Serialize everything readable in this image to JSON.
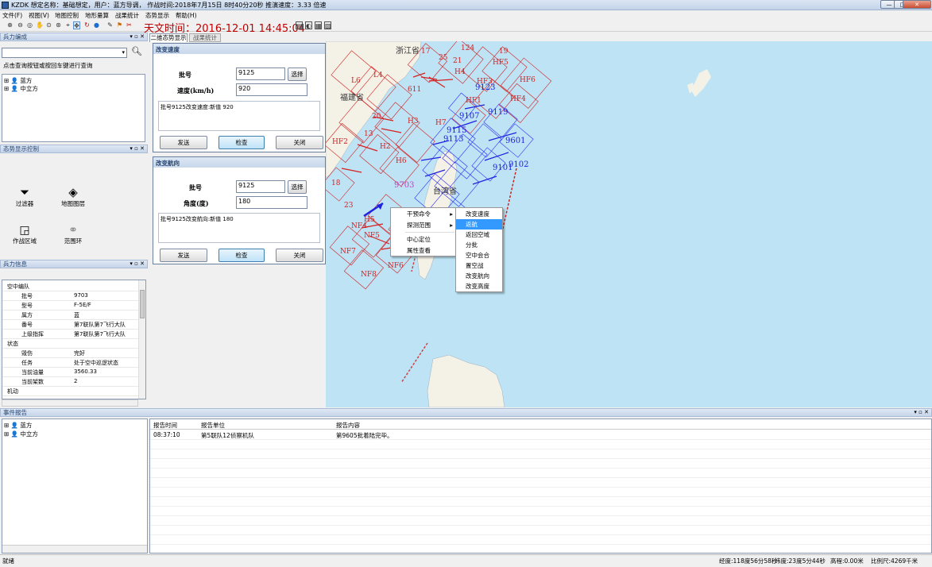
{
  "window": {
    "title": "KZDK  想定名称：基础想定，用户：蓝方导调，   作战时间:2018年7月15日 8时40分20秒    推演速度：3.33 倍速",
    "minimize": "—",
    "maximize": "□",
    "close": "✕"
  },
  "menu": [
    "文件(F)",
    "视图(V)",
    "地图控制",
    "地形量算",
    "战果统计",
    "态势显示",
    "帮助(H)"
  ],
  "toolbar": {
    "sky_time": "天文时间：2016-12-01 14:45:04"
  },
  "tabs": {
    "situation": "二维态势显示",
    "stats": "战果统计"
  },
  "force_panel": {
    "title": "兵力编成",
    "controls": "▾ ▫ ✕",
    "search_hint": "点击查询按钮或按回车键进行查询",
    "tree": [
      "蓝方",
      "中立方"
    ]
  },
  "situation_panel": {
    "title": "态势显示控制",
    "controls": "▾ ▫ ✕",
    "tools": [
      "过滤器",
      "地图图层",
      "作战区域",
      "范围环"
    ]
  },
  "force_info": {
    "title": "兵力信息",
    "controls": "▾ ▫ ✕",
    "groups": [
      {
        "name": "空中编队",
        "rows": [
          {
            "k": "批号",
            "v": "9703"
          },
          {
            "k": "型号",
            "v": "F-5E/F"
          },
          {
            "k": "属方",
            "v": "蓝"
          },
          {
            "k": "番号",
            "v": "第7联队第7飞行大队"
          },
          {
            "k": "上级指挥",
            "v": "第7联队第7飞行大队"
          }
        ]
      },
      {
        "name": "状态",
        "rows": [
          {
            "k": "毁伤",
            "v": "完好"
          },
          {
            "k": "任务",
            "v": "处于空中巡逻状态"
          },
          {
            "k": "当前油量",
            "v": "3560.33"
          },
          {
            "k": "当前架数",
            "v": "2"
          }
        ]
      },
      {
        "name": "机动",
        "rows": []
      }
    ]
  },
  "speed_dialog": {
    "title": "改变速度",
    "batch_label": "批号",
    "batch_value": "9125",
    "value_label": "速度(km/h)",
    "value": "920",
    "select": "选择",
    "log": "批号9125改变速度:新值 920",
    "send": "发送",
    "check": "检查",
    "close": "关闭"
  },
  "heading_dialog": {
    "title": "改变航向",
    "batch_label": "批号",
    "batch_value": "9125",
    "value_label": "角度(度)",
    "value": "180",
    "select": "选择",
    "log": "批号9125改变航向:新值 180",
    "send": "发送",
    "check": "检查",
    "close": "关闭"
  },
  "context_menu": {
    "main": [
      "干预命令",
      "探测范围",
      "中心定位",
      "属性查看"
    ],
    "sub": [
      "改变速度",
      "返航",
      "返回空域",
      "分批",
      "空中会合",
      "置空战",
      "改变航向",
      "改变高度"
    ],
    "highlight": "返航"
  },
  "map_labels": {
    "provinces": [
      "浙江省",
      "福建省",
      "台湾省"
    ],
    "red_units": [
      "17",
      "25",
      "21",
      "124",
      "19",
      "611",
      "L6",
      "L4",
      "H4",
      "HF5",
      "HF3",
      "HF6",
      "20",
      "13",
      "H3",
      "HF2",
      "H2",
      "H7",
      "H6",
      "18",
      "23",
      "NF4",
      "NF7",
      "NF5",
      "NF8",
      "NF6",
      "H5",
      "HF4",
      "HF1"
    ],
    "blue_units": [
      "9123",
      "9107",
      "9119",
      "9115",
      "9113",
      "9601",
      "9101",
      "9102",
      "9703"
    ]
  },
  "report": {
    "title": "事件报告",
    "controls": "▾ ▫ ✕",
    "tree": [
      "蓝方",
      "中立方"
    ],
    "columns": [
      "报告时间",
      "报告单位",
      "报告内容"
    ],
    "rows": [
      {
        "time": "08:37:10",
        "unit": "第5联队12侦察机队",
        "content": "第9605批着陆完毕。"
      }
    ]
  },
  "status": {
    "ready": "就绪",
    "lon": "经度:118度56分58秒",
    "lat": "纬度:23度5分44秒",
    "alt": "高程:0.00米",
    "scale": "比例尺:4269千米"
  }
}
